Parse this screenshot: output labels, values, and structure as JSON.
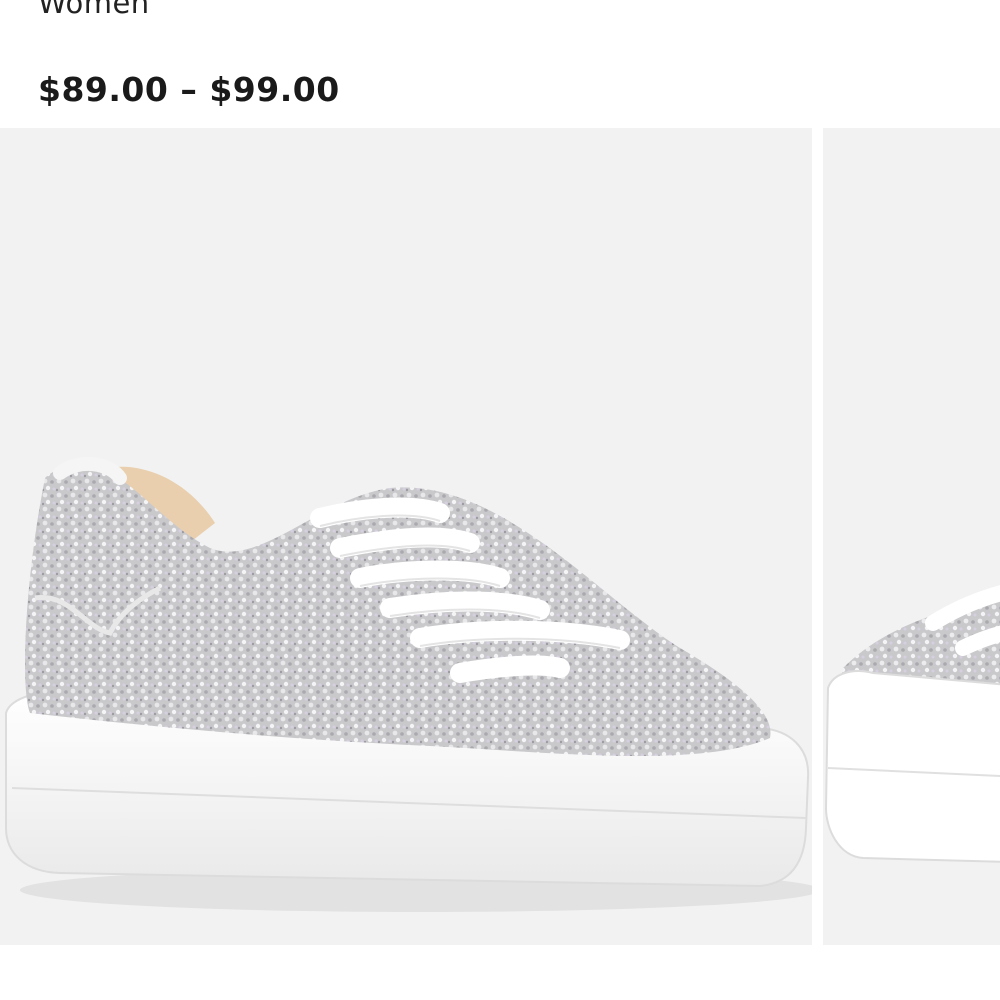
{
  "product": {
    "category": "Women",
    "price_range": "$89.00 – $99.00"
  },
  "gallery": {
    "images": [
      {
        "alt": "sparkle-sneaker-side-view"
      },
      {
        "alt": "sparkle-sneaker-alt-view"
      }
    ]
  },
  "colors": {
    "image_background": "#f2f2f2",
    "price_text": "#1a1a1a"
  }
}
